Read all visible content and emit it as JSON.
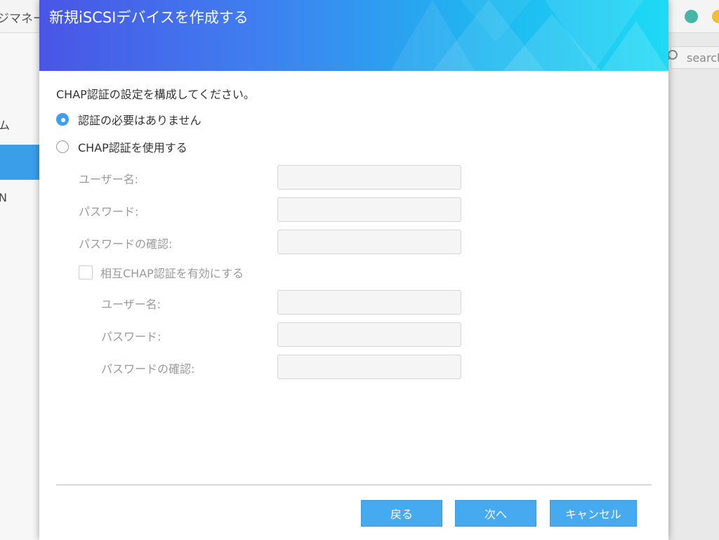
{
  "background": {
    "app_title": "ジマネー",
    "sidebar_items": [
      "ム",
      "N"
    ],
    "search_placeholder": "search",
    "window_dot_colors": [
      "#45b6a8",
      "#f2bd2e"
    ]
  },
  "dialog": {
    "title": "新規iSCSIデバイスを作成する",
    "intro": "CHAP認証の設定を構成してください。",
    "options": {
      "no_auth": {
        "label": "認証の必要はありません",
        "selected": true
      },
      "use_chap": {
        "label": "CHAP認証を使用する",
        "selected": false
      }
    },
    "chap": {
      "username_label": "ユーザー名:",
      "password_label": "パスワード:",
      "confirm_label": "パスワードの確認:",
      "username_value": "",
      "password_value": "",
      "confirm_value": ""
    },
    "mutual": {
      "checkbox_label": "相互CHAP認証を有効にする",
      "checked": false,
      "username_label": "ユーザー名:",
      "password_label": "パスワード:",
      "confirm_label": "パスワードの確認:",
      "username_value": "",
      "password_value": "",
      "confirm_value": ""
    },
    "buttons": {
      "back": "戻る",
      "next": "次へ",
      "cancel": "キャンセル"
    },
    "colors": {
      "accent": "#45aaf0",
      "header_start": "#4a55e6",
      "header_end": "#1ddaf5"
    }
  }
}
